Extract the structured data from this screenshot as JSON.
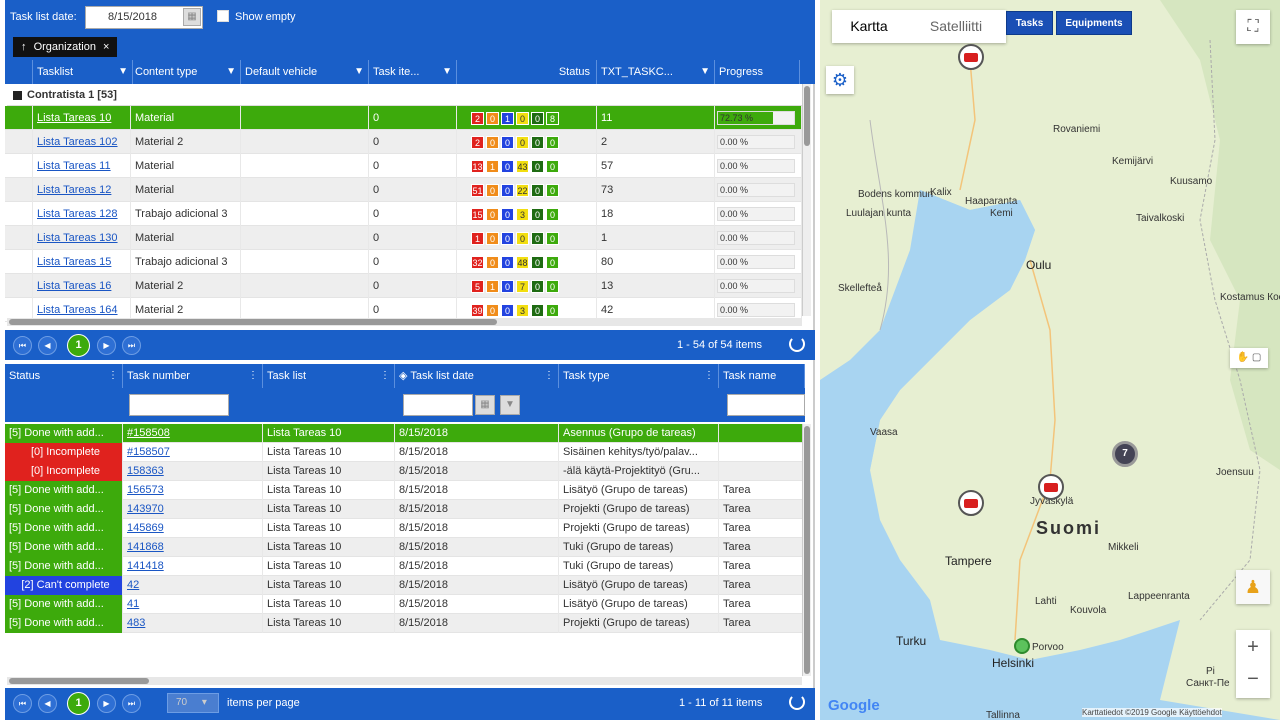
{
  "topbar": {
    "date_label": "Task list date:",
    "date_value": "8/15/2018",
    "show_empty": "Show empty"
  },
  "group_chip": {
    "label": "Organization",
    "close": "×",
    "arrow": "↑"
  },
  "grid1": {
    "headers": [
      "Tasklist",
      "Content type",
      "Default vehicle",
      "Task ite...",
      "Status",
      "TXT_TASKC...",
      "Progress"
    ],
    "group_caption": "Contratista 1 [53]",
    "rows": [
      {
        "tasklist": "Lista Tareas 10",
        "content": "Material",
        "vehicle": "",
        "items": "0",
        "s": [
          "2",
          "0",
          "1",
          "0",
          "0",
          "8"
        ],
        "txt": "11",
        "progress": "72.73 %",
        "pct": 72.73
      },
      {
        "tasklist": "Lista Tareas 102",
        "content": "Material 2",
        "vehicle": "",
        "items": "0",
        "s": [
          "2",
          "0",
          "0",
          "0",
          "0",
          "0"
        ],
        "txt": "2",
        "progress": "0.00 %",
        "pct": 0
      },
      {
        "tasklist": "Lista Tareas 11",
        "content": "Material",
        "vehicle": "",
        "items": "0",
        "s": [
          "13",
          "1",
          "0",
          "43",
          "0",
          "0"
        ],
        "txt": "57",
        "progress": "0.00 %",
        "pct": 0
      },
      {
        "tasklist": "Lista Tareas 12",
        "content": "Material",
        "vehicle": "",
        "items": "0",
        "s": [
          "51",
          "0",
          "0",
          "22",
          "0",
          "0"
        ],
        "txt": "73",
        "progress": "0.00 %",
        "pct": 0
      },
      {
        "tasklist": "Lista Tareas 128",
        "content": "Trabajo adicional 3",
        "vehicle": "",
        "items": "0",
        "s": [
          "15",
          "0",
          "0",
          "3",
          "0",
          "0"
        ],
        "txt": "18",
        "progress": "0.00 %",
        "pct": 0
      },
      {
        "tasklist": "Lista Tareas 130",
        "content": "Material",
        "vehicle": "",
        "items": "0",
        "s": [
          "1",
          "0",
          "0",
          "0",
          "0",
          "0"
        ],
        "txt": "1",
        "progress": "0.00 %",
        "pct": 0
      },
      {
        "tasklist": "Lista Tareas 15",
        "content": "Trabajo adicional 3",
        "vehicle": "",
        "items": "0",
        "s": [
          "32",
          "0",
          "0",
          "48",
          "0",
          "0"
        ],
        "txt": "80",
        "progress": "0.00 %",
        "pct": 0
      },
      {
        "tasklist": "Lista Tareas 16",
        "content": "Material 2",
        "vehicle": "",
        "items": "0",
        "s": [
          "5",
          "1",
          "0",
          "7",
          "0",
          "0"
        ],
        "txt": "13",
        "progress": "0.00 %",
        "pct": 0
      },
      {
        "tasklist": "Lista Tareas 164",
        "content": "Material 2",
        "vehicle": "",
        "items": "0",
        "s": [
          "39",
          "0",
          "0",
          "3",
          "0",
          "0"
        ],
        "txt": "42",
        "progress": "0.00 %",
        "pct": 0
      }
    ],
    "status_colors": [
      "#e0221e",
      "#f08c1a",
      "#2243e0",
      "#f2de10",
      "#1e6b12",
      "#3daa0c"
    ],
    "pager": {
      "current": "1",
      "info": "1 - 54 of 54 items"
    }
  },
  "grid2": {
    "headers": [
      "Status",
      "Task number",
      "Task list",
      "Task list date",
      "Task type",
      "Task name"
    ],
    "rows": [
      {
        "status": "[5] Done with add...",
        "kind": "green",
        "num": "#158508",
        "list": "Lista Tareas 10",
        "date": "8/15/2018",
        "type": "Asennus (Grupo de tareas)",
        "name": ""
      },
      {
        "status": "[0] Incomplete",
        "kind": "red",
        "num": "#158507",
        "list": "Lista Tareas 10",
        "date": "8/15/2018",
        "type": "Sisäinen kehitys/työ/palav...",
        "name": ""
      },
      {
        "status": "[0] Incomplete",
        "kind": "red",
        "num": "158363",
        "list": "Lista Tareas 10",
        "date": "8/15/2018",
        "type": "-älä käytä-Projektityö (Gru...",
        "name": ""
      },
      {
        "status": "[5] Done with add...",
        "kind": "green",
        "num": "156573",
        "list": "Lista Tareas 10",
        "date": "8/15/2018",
        "type": "Lisätyö (Grupo de tareas)",
        "name": "Tarea"
      },
      {
        "status": "[5] Done with add...",
        "kind": "green",
        "num": "143970",
        "list": "Lista Tareas 10",
        "date": "8/15/2018",
        "type": "Projekti (Grupo de tareas)",
        "name": "Tarea"
      },
      {
        "status": "[5] Done with add...",
        "kind": "green",
        "num": "145869",
        "list": "Lista Tareas 10",
        "date": "8/15/2018",
        "type": "Projekti (Grupo de tareas)",
        "name": "Tarea"
      },
      {
        "status": "[5] Done with add...",
        "kind": "green",
        "num": "141868",
        "list": "Lista Tareas 10",
        "date": "8/15/2018",
        "type": "Tuki (Grupo de tareas)",
        "name": "Tarea"
      },
      {
        "status": "[5] Done with add...",
        "kind": "green",
        "num": "141418",
        "list": "Lista Tareas 10",
        "date": "8/15/2018",
        "type": "Tuki (Grupo de tareas)",
        "name": "Tarea"
      },
      {
        "status": "[2] Can't complete",
        "kind": "blue",
        "num": "42",
        "list": "Lista Tareas 10",
        "date": "8/15/2018",
        "type": "Lisätyö (Grupo de tareas)",
        "name": "Tarea"
      },
      {
        "status": "[5] Done with add...",
        "kind": "green",
        "num": "41",
        "list": "Lista Tareas 10",
        "date": "8/15/2018",
        "type": "Lisätyö (Grupo de tareas)",
        "name": "Tarea"
      },
      {
        "status": "[5] Done with add...",
        "kind": "green",
        "num": "483",
        "list": "Lista Tareas 10",
        "date": "8/15/2018",
        "type": "Projekti (Grupo de tareas)",
        "name": "Tarea"
      }
    ],
    "pager": {
      "current": "1",
      "per_page": "70",
      "per_page_label": "items per page",
      "info": "1 - 11 of 11 items"
    }
  },
  "map": {
    "tab_map": "Kartta",
    "tab_sat": "Satelliitti",
    "btn_tasks": "Tasks",
    "btn_equipments": "Equipments",
    "places": {
      "rovaniemi": "Rovaniemi",
      "kuusamo": "Kuusamo",
      "luulajan": "Luulajan kunta",
      "kemi": "Kemi",
      "taivalkoski": "Taivalkoski",
      "oulu": "Oulu",
      "skelleftea": "Skellefteå",
      "kostamus": "Kostamus\nКостомукша",
      "vaasa": "Vaasa",
      "jyvaskyla": "Jyväskylä",
      "joensuu": "Joensuu",
      "suomi": "Suomi",
      "mikkeli": "Mikkeli",
      "tampere": "Tampere",
      "lahti": "Lahti",
      "kouvola": "Kouvola",
      "lappeenranta": "Lappeenranta",
      "turku": "Turku",
      "porvoo": "Porvoo",
      "helsinki": "Helsinki",
      "tallinn": "Tallinna",
      "boden": "Bodens kommun",
      "kalix": "Kalix",
      "haparanda": "Haaparanta",
      "kemijarvi": "Kemijärvi",
      "sanktp": "Санкт-Пе",
      "pi": "Pi"
    },
    "cluster": "7",
    "google": "Google",
    "attribution": "Karttatiedot ©2019 Google   Käyttöehdot",
    "zoom_in": "+",
    "zoom_out": "−"
  }
}
